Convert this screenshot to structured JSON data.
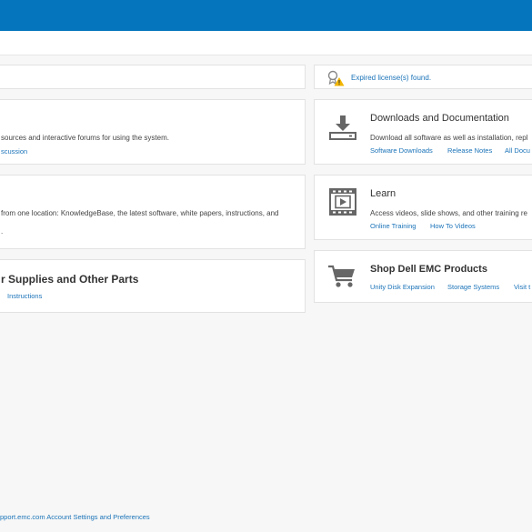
{
  "alert": {
    "text": "Expired license(s) found."
  },
  "left_cards": {
    "card1": {
      "desc": "sources and interactive forums for using the system.",
      "link": "scussion"
    },
    "card2": {
      "desc": "from one location: KnowledgeBase, the latest software, white papers, instructions, and",
      "extra": "."
    },
    "card3": {
      "title": "r Supplies and Other Parts",
      "link": "Instructions"
    }
  },
  "right_cards": {
    "downloads": {
      "title": "Downloads and Documentation",
      "desc": "Download all software as well as installation, repl",
      "links": [
        "Software Downloads",
        "Release Notes",
        "All Docu"
      ]
    },
    "learn": {
      "title": "Learn",
      "desc": "Access videos, slide shows, and other training re",
      "links": [
        "Online Training",
        "How To Videos"
      ]
    },
    "shop": {
      "title": "Shop Dell EMC Products",
      "links": [
        "Unity Disk Expansion",
        "Storage Systems",
        "Visit t"
      ]
    }
  },
  "footer": {
    "text": "pport.emc.com Account Settings and Preferences"
  },
  "colors": {
    "brand": "#0576bd",
    "link": "#1a73b8",
    "warning": "#f2b600"
  },
  "icons": [
    "certificate-warning-icon",
    "download-icon",
    "video-icon",
    "shopping-cart-icon"
  ]
}
